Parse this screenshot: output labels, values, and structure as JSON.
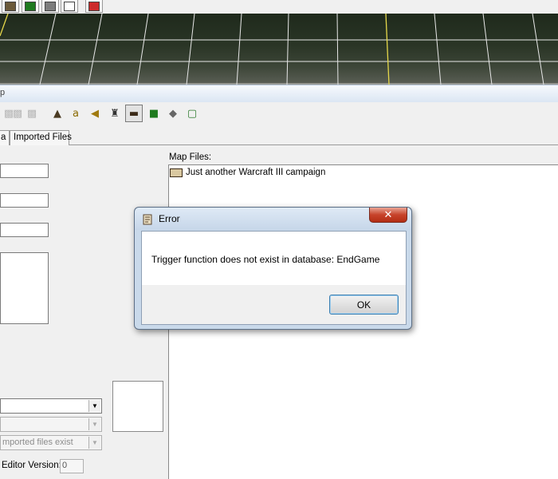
{
  "background_window": {
    "top_toolbar_icons": [
      "terrain-tool-icon",
      "green-tile-icon",
      "cube-icon",
      "new-doc-icon",
      "red-alert-icon"
    ],
    "title_fragment": "p",
    "toolbar_icons": [
      "disabled-tool-icon",
      "disabled-tool-icon",
      "disabled-tool-icon",
      "terrain-icon",
      "ability-icon",
      "sound-icon",
      "ai-icon",
      "import-manager-icon",
      "object-editor-icon",
      "cube-icon",
      "new-doc-icon"
    ],
    "tabs": [
      {
        "label": "a"
      },
      {
        "label": "Imported Files"
      }
    ],
    "map_files_label": "Map Files:",
    "map_files": [
      "Just another Warcraft III campaign"
    ],
    "combo_1": {
      "value": ""
    },
    "combo_2": {
      "value": ""
    },
    "combo_3": {
      "value": "mported files exist"
    },
    "editor_version_label": "Editor Version:",
    "editor_version_value": "0"
  },
  "error_dialog": {
    "title": "Error",
    "close_label": "✕",
    "message": "Trigger function does not exist in database: EndGame",
    "ok_label": "OK"
  },
  "colors": {
    "dialog_frame": "#c9d9ea",
    "close_button": "#c7432b",
    "terrain_grid": "#e8e8e8",
    "terrain_highlight": "#e6d84a"
  }
}
